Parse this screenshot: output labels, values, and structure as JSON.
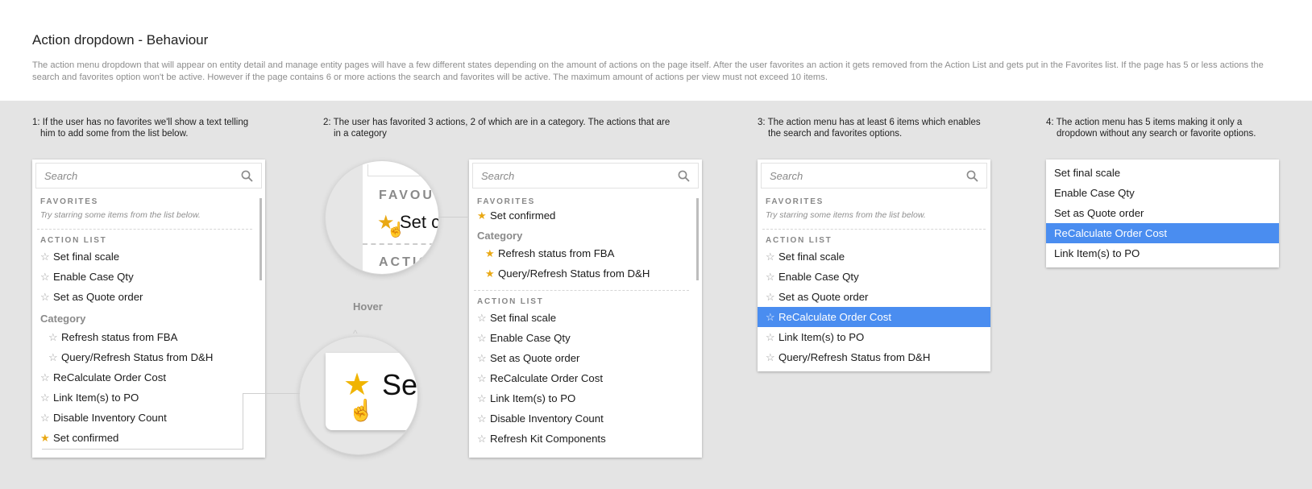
{
  "header": {
    "title": "Action dropdown - Behaviour",
    "description": "The action menu dropdown that will appear on entity detail and manage entity pages will have a few different states depending on the amount of actions on the page itself. After the user favorites an action it gets removed from the Action List and gets put in the Favorites list. If the page has 5 or less actions the search and favorites option won't be active. However if the page contains 6 or more actions the search and favorites will be active. The maximum amount of actions per view must not exceed 10 items."
  },
  "captions": {
    "c1": [
      "1: If the user has no favorites we'll show a text telling",
      "him to add some from the list below."
    ],
    "c2": [
      "2: The user has favorited 3 actions, 2 of which are in a category. The actions that are",
      "in a category"
    ],
    "c3": [
      "3: The action menu has at least 6 items which enables",
      "the search and favorites options."
    ],
    "c4": [
      "4: The action menu has 5 items making it only a",
      "dropdown without any search or favorite options."
    ]
  },
  "common": {
    "search_placeholder": "Search",
    "favorites_header": "FAVORITES",
    "action_list_header": "ACTION LIST",
    "category_label": "Category",
    "empty_hint": "Try starring some items from the list below.",
    "hover_label": "Hover",
    "zoom_top_header": "FAVOUR",
    "zoom_top_item": "Set co",
    "zoom_top_action": "ACTIO",
    "zoom_bottom_item": "Se"
  },
  "panel1": {
    "items": [
      "Set final scale",
      "Enable Case Qty",
      "Set as Quote order"
    ],
    "category_items": [
      "Refresh status from FBA",
      "Query/Refresh Status from D&H"
    ],
    "items2": [
      "ReCalculate Order Cost",
      "Link Item(s) to PO",
      "Disable Inventory Count",
      "Set confirmed"
    ]
  },
  "panel2": {
    "favorites": [
      "Set confirmed"
    ],
    "favorite_category_items": [
      "Refresh status from FBA",
      "Query/Refresh Status from D&H"
    ],
    "items": [
      "Set final scale",
      "Enable Case Qty",
      "Set as Quote order",
      "ReCalculate Order Cost",
      "Link Item(s) to PO",
      "Disable Inventory Count",
      "Refresh Kit Components"
    ]
  },
  "panel3": {
    "items": [
      "Set final scale",
      "Enable Case Qty",
      "Set as Quote order",
      "ReCalculate Order Cost",
      "Link Item(s) to PO",
      "Query/Refresh Status from D&H"
    ],
    "selected_index": 3
  },
  "panel4": {
    "items": [
      "Set final scale",
      "Enable Case Qty",
      "Set as Quote order",
      "ReCalculate Order Cost",
      "Link Item(s) to PO"
    ],
    "selected_index": 3
  },
  "colors": {
    "accent": "#4a8df0",
    "star_on": "#e9a814",
    "canvas": "#e4e4e4"
  }
}
